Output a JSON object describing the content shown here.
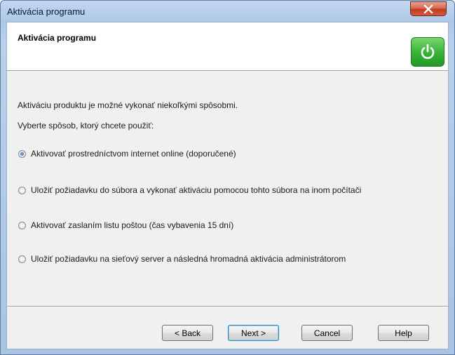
{
  "window": {
    "title": "Aktivácia programu"
  },
  "header": {
    "title": "Aktivácia programu",
    "logo_icon": "power-icon"
  },
  "content": {
    "line1": "Aktiváciu produktu je možné vykonať niekoľkými spôsobmi.",
    "line2": "Vyberte spôsob, ktorý chcete použiť:"
  },
  "options": [
    {
      "label": "Aktivovať prostredníctvom internet online (doporučené)",
      "checked": true
    },
    {
      "label": "Uložiť požiadavku do súbora a vykonať aktiváciu pomocou tohto súbora na inom počítači",
      "checked": false
    },
    {
      "label": "Aktivovať zaslaním listu poštou (čas vybavenia 15 dní)",
      "checked": false
    },
    {
      "label": "Uložiť požiadavku na sieťový server a následná hromadná aktivácia administrátorom",
      "checked": false
    }
  ],
  "buttons": {
    "back": "< Back",
    "next": "Next >",
    "cancel": "Cancel",
    "help": "Help"
  },
  "colors": {
    "logo_green": "#36b135",
    "close_red": "#c53a22"
  }
}
